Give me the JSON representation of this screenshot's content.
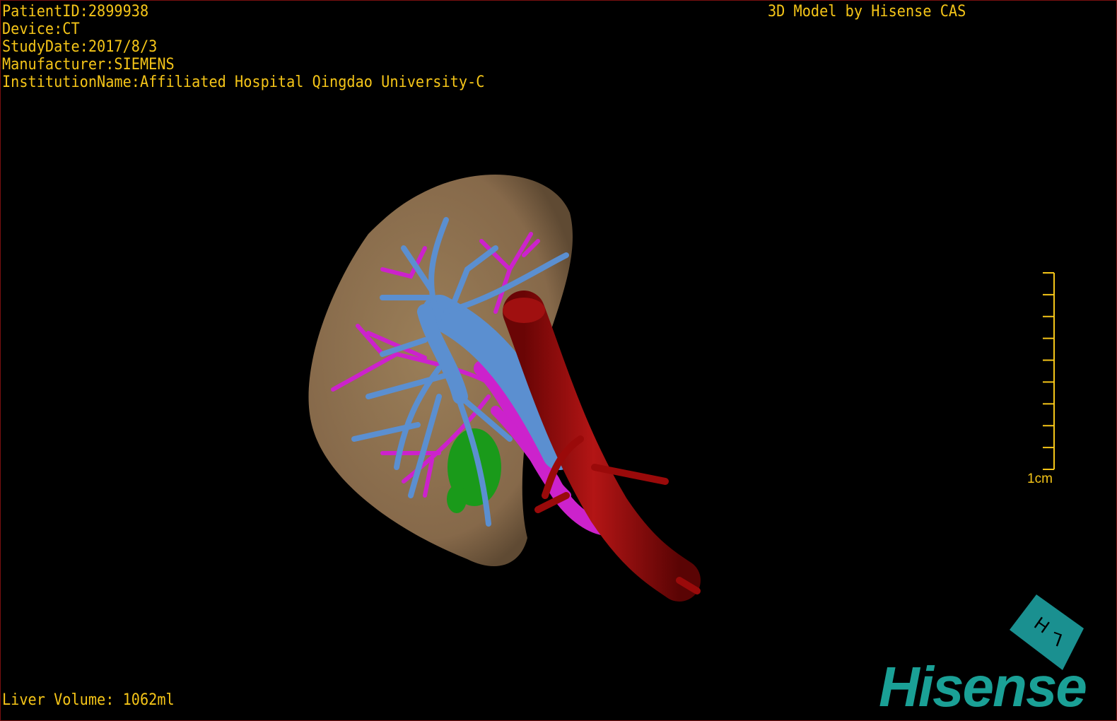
{
  "info": {
    "patient_id": "PatientID:2899938",
    "device": "Device:CT",
    "study_date": "StudyDate:2017/8/3",
    "manufacturer": "Manufacturer:SIEMENS",
    "institution": "InstitutionName:Affiliated Hospital Qingdao University-C"
  },
  "credit": "3D Model by Hisense CAS",
  "liver_volume": "Liver Volume: 1062ml",
  "scale_bar": {
    "label": "1cm",
    "ticks": 10
  },
  "logo": {
    "text": "Hisense",
    "cube_letters": "H L"
  },
  "colors": {
    "text": "#f5c518",
    "liver": "#8b6f4a",
    "portal_vein": "#5b8fd0",
    "hepatic_vein": "#cc22cc",
    "artery": "#9a0a0a",
    "gallbladder": "#1a9a1a",
    "logo": "#1aa096"
  }
}
